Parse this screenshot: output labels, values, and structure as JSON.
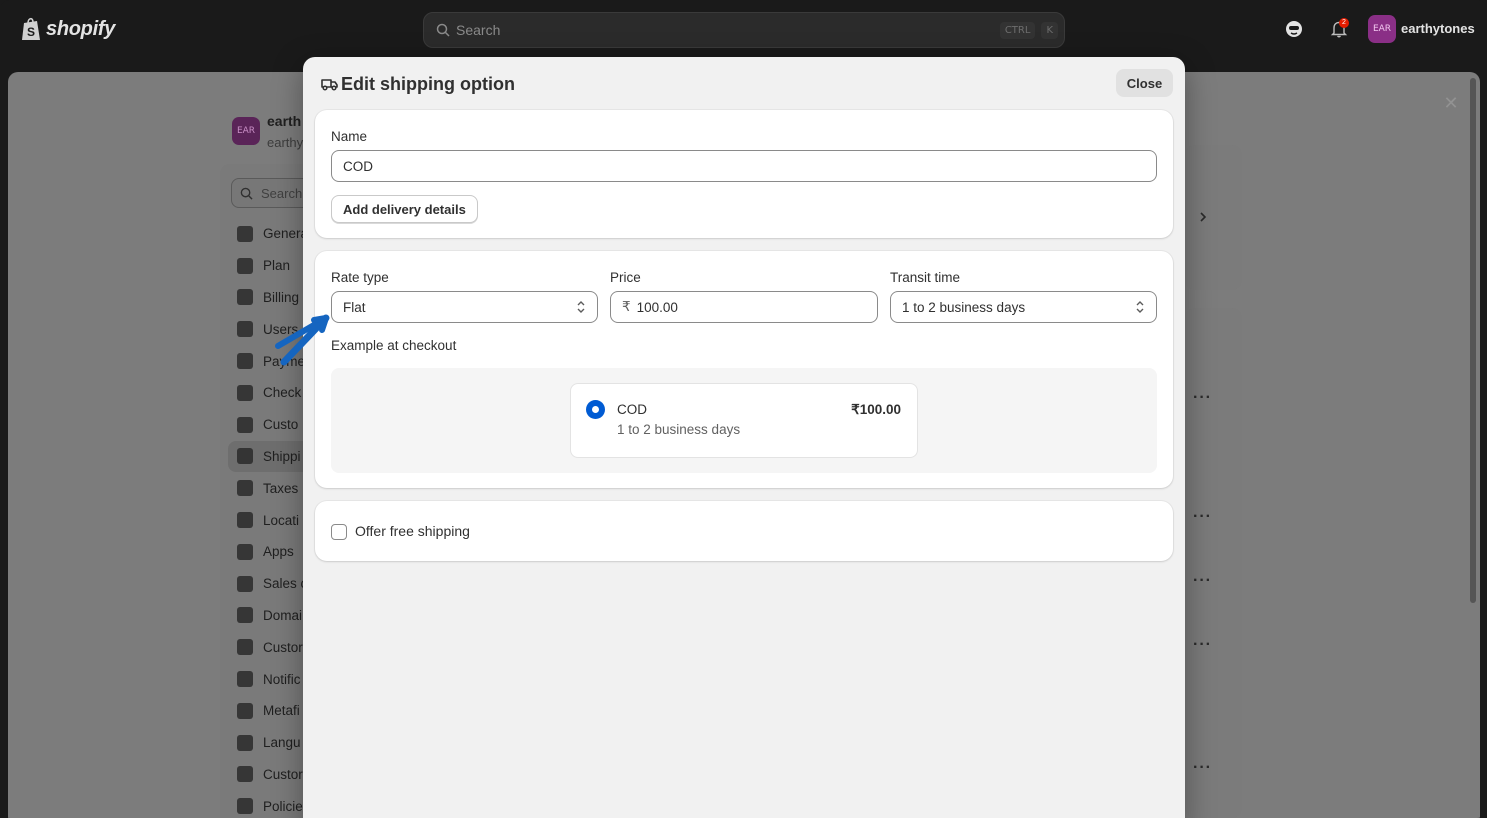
{
  "topbar": {
    "brand": "shopify",
    "search_placeholder": "Search",
    "shortcut_ctrl": "CTRL",
    "shortcut_key": "K",
    "notification_count": "2",
    "store_initials": "EAR",
    "store_name": "earthytones"
  },
  "background": {
    "store_initials": "EAR",
    "store_name_partial": "earth",
    "store_handle_partial": "earthy",
    "search_placeholder_partial": "Search",
    "nav_items": [
      "Genera",
      "Plan",
      "Billing",
      "Users",
      "Payme",
      "Check",
      "Custo",
      "Shippi",
      "Taxes",
      "Locati",
      "Apps",
      "Sales c",
      "Domai",
      "Custor",
      "Notific",
      "Metafi",
      "Langu",
      "Custor",
      "Policie"
    ],
    "active_nav_index": 7
  },
  "modal": {
    "title": "Edit shipping option",
    "close_label": "Close",
    "name_section": {
      "label": "Name",
      "value": "COD",
      "add_details_label": "Add delivery details"
    },
    "rate_section": {
      "rate_type_label": "Rate type",
      "rate_type_value": "Flat",
      "price_label": "Price",
      "price_prefix": "₹",
      "price_value": "100.00",
      "transit_label": "Transit time",
      "transit_value": "1 to 2 business days",
      "example_label": "Example at checkout",
      "example": {
        "name": "COD",
        "days": "1 to 2 business days",
        "price": "₹100.00"
      }
    },
    "free_shipping": {
      "label": "Offer free shipping",
      "checked": false
    }
  },
  "colors": {
    "accent": "#005bd3",
    "annotation": "#1565c0"
  }
}
